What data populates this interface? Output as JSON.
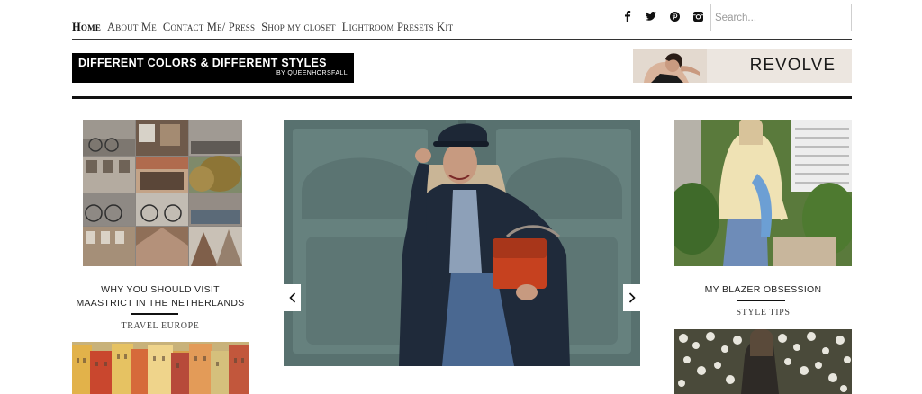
{
  "nav": {
    "items": [
      {
        "label": "Home",
        "active": true
      },
      {
        "label": "About Me",
        "active": false
      },
      {
        "label": "Contact Me/ Press",
        "active": false
      },
      {
        "label": "Shop my closet",
        "active": false
      },
      {
        "label": "Lightroom Presets Kit",
        "active": false
      }
    ]
  },
  "social": [
    "facebook-icon",
    "twitter-icon",
    "pinterest-icon",
    "instagram-icon"
  ],
  "search": {
    "placeholder": "Search..."
  },
  "logo": {
    "title": "DIFFERENT COLORS & DIFFERENT STYLES",
    "subtitle": "BY QUEENHORSFALL"
  },
  "banner": {
    "brand": "REVOLVE"
  },
  "left_post": {
    "title": "WHY YOU SHOULD VISIT MAASTRICT IN THE NETHERLANDS",
    "category": "TRAVEL EUROPE"
  },
  "right_post": {
    "title": "MY BLAZER OBSESSION",
    "category": "STYLE TIPS"
  },
  "colors": {
    "accent": "#000000",
    "text": "#222222",
    "rule": "#111111"
  }
}
